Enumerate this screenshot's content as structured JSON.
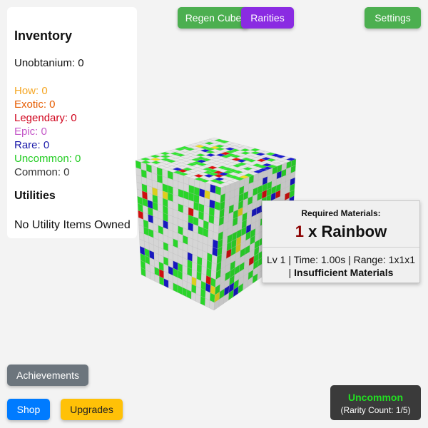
{
  "buttons": {
    "regen_cube": "Regen Cube",
    "rarities": "Rarities",
    "settings": "Settings",
    "achievements": "Achievements",
    "shop": "Shop",
    "upgrades": "Upgrades"
  },
  "inventory": {
    "title": "Inventory",
    "unobtanium": "Unobtanium: 0",
    "rarities": [
      {
        "label": "How: 0",
        "color": "#f5a623"
      },
      {
        "label": "Exotic: 0",
        "color": "#e65c00"
      },
      {
        "label": "Legendary: 0",
        "color": "#d0021b"
      },
      {
        "label": "Epic: 0",
        "color": "#c458c8"
      },
      {
        "label": "Rare: 0",
        "color": "#1a1aaa"
      },
      {
        "label": "Uncommon: 0",
        "color": "#22cc22"
      },
      {
        "label": "Common: 0",
        "color": "#333333"
      }
    ],
    "utilities_title": "Utilities",
    "utilities_text": "No Utility Items Owned"
  },
  "required_materials": {
    "header": "Required Materials:",
    "quantity": "1",
    "material": "x Rainbow",
    "line1": "Lv 1 | Time: 1.00s | Range: 1x1x1",
    "line2_prefix": "| ",
    "line2_status": "Insufficient Materials"
  },
  "current_rarity": {
    "name": "Uncommon",
    "count_text": "(Rarity Count: 1/5)"
  },
  "colors": {
    "green_button": "#4caf50",
    "purple_button": "#8a2be2",
    "gray_button": "#6c757d",
    "blue_button": "#007bff",
    "yellow_button": "#ffc107"
  }
}
